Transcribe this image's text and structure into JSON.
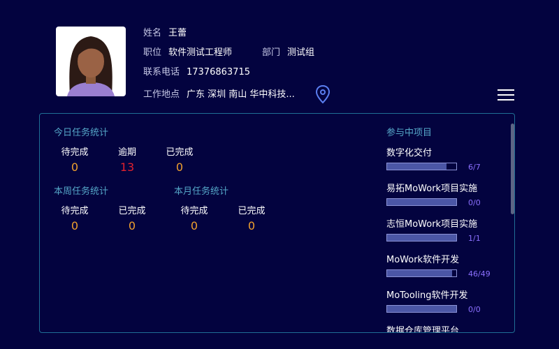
{
  "profile": {
    "name_label": "姓名",
    "name": "王蕾",
    "position_label": "职位",
    "position": "软件测试工程师",
    "dept_label": "部门",
    "dept": "测试组",
    "phone_label": "联系电话",
    "phone": "17376863715",
    "location_label": "工作地点",
    "location": "广东 深圳 南山 华中科技..."
  },
  "icons": {
    "avatar": "avatar-female",
    "location": "map-pin-icon",
    "menu": "hamburger-menu-icon"
  },
  "today": {
    "title": "今日任务统计",
    "items": [
      {
        "label": "待完成",
        "value": "0"
      },
      {
        "label": "逾期",
        "value": "13"
      },
      {
        "label": "已完成",
        "value": "0"
      }
    ]
  },
  "week": {
    "title": "本周任务统计",
    "items": [
      {
        "label": "待完成",
        "value": "0"
      },
      {
        "label": "已完成",
        "value": "0"
      }
    ]
  },
  "month": {
    "title": "本月任务统计",
    "items": [
      {
        "label": "待完成",
        "value": "0"
      },
      {
        "label": "已完成",
        "value": "0"
      }
    ]
  },
  "projects": {
    "title": "参与中项目",
    "items": [
      {
        "name": "数字化交付",
        "progress": "6/7",
        "ratio": 0.857
      },
      {
        "name": "易拓MoWork项目实施",
        "progress": "0/0",
        "ratio": 1
      },
      {
        "name": "志恒MoWork项目实施",
        "progress": "1/1",
        "ratio": 1
      },
      {
        "name": "MoWork软件开发",
        "progress": "46/49",
        "ratio": 0.939
      },
      {
        "name": "MoTooling软件开发",
        "progress": "0/0",
        "ratio": 1
      },
      {
        "name": "数据仓库管理平台",
        "progress": "",
        "ratio": 0
      }
    ]
  },
  "colors": {
    "background": "#03033f",
    "accent": "#55a7c8",
    "count": "#f0a02e",
    "overdue": "#e0212e",
    "progress_text": "#8c70ff"
  }
}
